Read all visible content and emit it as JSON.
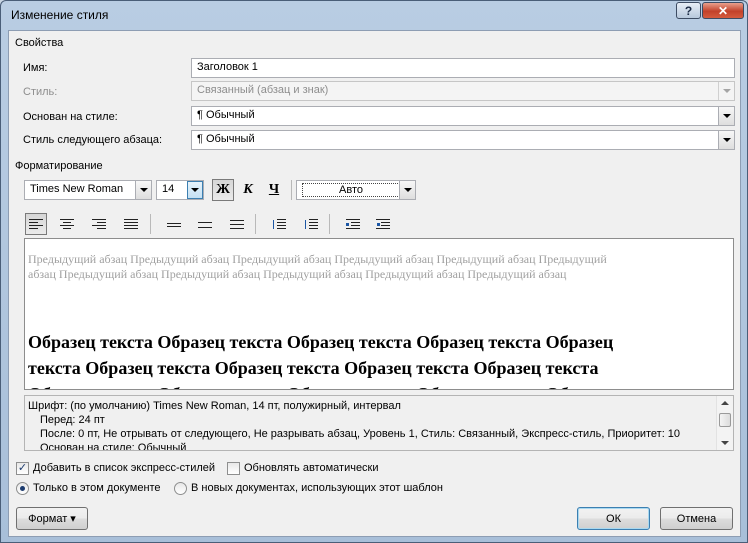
{
  "window": {
    "title": "Изменение стиля",
    "help_label": "?",
    "close_label": "✕"
  },
  "properties": {
    "group_label": "Свойства",
    "name_label": "Имя:",
    "name_value": "Заголовок 1",
    "style_type_label": "Стиль:",
    "style_type_value": "Связанный (абзац и знак)",
    "based_on_label": "Основан на стиле:",
    "based_on_value": "¶  Обычный",
    "next_style_label": "Стиль следующего абзаца:",
    "next_style_value": "¶  Обычный"
  },
  "formatting": {
    "group_label": "Форматирование",
    "font_name": "Times New Roman",
    "font_size": "14",
    "bold_label": "Ж",
    "italic_label": "К",
    "underline_label": "Ч",
    "color_value": "Авто",
    "icons": [
      "align-left-icon",
      "align-center-icon",
      "align-right-icon",
      "justify-icon",
      "line-spacing-single-icon",
      "line-spacing-1-5-icon",
      "line-spacing-double-icon",
      "space-before-increase-icon",
      "space-before-decrease-icon",
      "indent-decrease-icon",
      "indent-increase-icon"
    ]
  },
  "preview": {
    "previous_paragraph": "Предыдущий абзац Предыдущий абзац Предыдущий абзац Предыдущий абзац Предыдущий абзац Предыдущий абзац Предыдущий абзац Предыдущий абзац Предыдущий абзац Предыдущий абзац Предыдущий абзац",
    "sample_text": "Образец текста Образец текста Образец текста Образец текста Образец текста Образец текста Образец текста Образец текста Образец текста Образец текста Образец текста Образец текста Образец текста Образец"
  },
  "description": {
    "line1": "Шрифт: (по умолчанию) Times New Roman, 14 пт, полужирный, интервал",
    "line2": "Перед:  24 пт",
    "line3": "После:  0 пт, Не отрывать от следующего, Не разрывать абзац, Уровень 1, Стиль: Связанный, Экспресс-стиль, Приоритет: 10",
    "line4": "Основан на стиле: Обычный"
  },
  "options": {
    "add_to_quick_styles_label": "Добавить в список экспресс-стилей",
    "add_to_quick_styles_checked": true,
    "auto_update_label": "Обновлять автоматически",
    "auto_update_checked": false,
    "only_this_document_label": "Только в этом документе",
    "only_this_document_selected": true,
    "new_documents_label": "В новых документах, использующих этот шаблон",
    "new_documents_selected": false
  },
  "buttons": {
    "format_label": "Формат ▾",
    "ok_label": "ОК",
    "cancel_label": "Отмена"
  },
  "colors": {
    "window_frame": "#b9cde3",
    "client_bg": "#f0f0f0",
    "close_button": "#c2412a",
    "accent": "#3c7fb1"
  }
}
